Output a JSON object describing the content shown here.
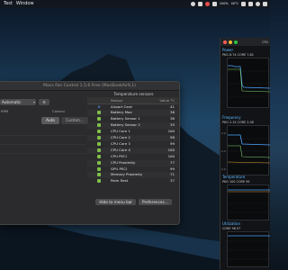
{
  "menubar": {
    "apple": "",
    "app": "Test",
    "items": [
      "Window"
    ],
    "tray_stat": [
      "100%",
      "40°C",
      "98%"
    ]
  },
  "mfc": {
    "title": "Macs Fan Control 1.5.6 Free (MacBookAir9,1)",
    "preset": "Automatic",
    "preset_btn": "⚙",
    "fan_headers": {
      "rpm": "RPM",
      "control": "Control"
    },
    "auto_label": "Auto",
    "custom_label": "Custom...",
    "sensors_title": "Temperature sensors",
    "sensor_headers": {
      "sensor": "Sensor",
      "value": "Value °C"
    },
    "sensors": [
      {
        "name": "Airport Card",
        "value": "41",
        "icon": "wifi-icon"
      },
      {
        "name": "Battery Max",
        "value": "36",
        "icon": "chip-icon"
      },
      {
        "name": "Battery Sensor 1",
        "value": "36",
        "icon": "chip-icon"
      },
      {
        "name": "Battery Sensor 2",
        "value": "35",
        "icon": "chip-icon"
      },
      {
        "name": "CPU Core 1",
        "value": "100",
        "icon": "chip-icon"
      },
      {
        "name": "CPU Core 2",
        "value": "98",
        "icon": "chip-icon"
      },
      {
        "name": "CPU Core 3",
        "value": "99",
        "icon": "chip-icon"
      },
      {
        "name": "CPU Core 4",
        "value": "100",
        "icon": "chip-icon"
      },
      {
        "name": "CPU PECI",
        "value": "100",
        "icon": "chip-icon"
      },
      {
        "name": "CPU Proximity",
        "value": "77",
        "icon": "chip-icon"
      },
      {
        "name": "GPU PECI",
        "value": "99",
        "icon": "chip-icon"
      },
      {
        "name": "Memory Proximity",
        "value": "71",
        "icon": "chip-icon"
      },
      {
        "name": "Palm Rest",
        "value": "37",
        "icon": "chip-icon"
      }
    ],
    "hide_btn": "Hide to menu bar",
    "prefs_btn": "Preferences..."
  },
  "monitor": {
    "toptext": "CPU",
    "power": {
      "label": "Power",
      "stats": "PKG  8.74   CORE  7.82"
    },
    "frequency": {
      "label": "Frequency",
      "stats": "PKG  2.15   CORE  2.08",
      "ticks": [
        "2.0",
        "2.0",
        "2.0"
      ]
    },
    "temperature": {
      "label": "Temperature",
      "stats": "PKG  100   CORE  99"
    },
    "utilization": {
      "label": "Utilization",
      "stats": "CORE  96.57"
    },
    "colors": {
      "accent": "#5cb8ff",
      "line": "#4ea6ff"
    }
  }
}
